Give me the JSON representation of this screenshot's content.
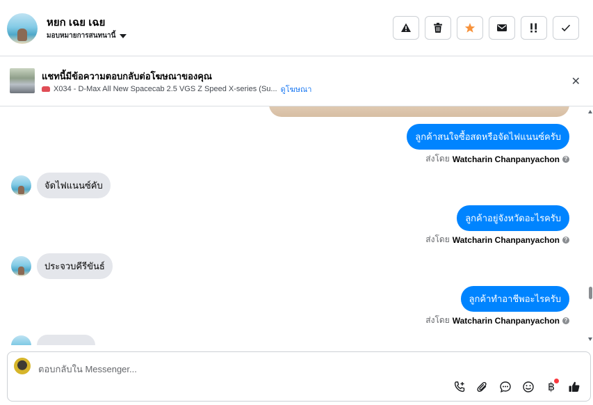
{
  "header": {
    "name": "หยก เฉย เฉย",
    "assign_label": "มอบหมายการสนทนานี้",
    "actions": [
      {
        "name": "report-spam-button",
        "icon": "warning-triangle-icon",
        "glyph": "⚠"
      },
      {
        "name": "delete-button",
        "icon": "trash-icon",
        "glyph": "🗑"
      },
      {
        "name": "star-button",
        "icon": "star-icon",
        "glyph": "★",
        "color": "#f7923b"
      },
      {
        "name": "email-button",
        "icon": "envelope-icon",
        "glyph": "✉"
      },
      {
        "name": "follow-up-button",
        "icon": "double-exclamation-icon",
        "glyph": "!!"
      },
      {
        "name": "mark-done-button",
        "icon": "checkmark-icon",
        "glyph": "✓"
      }
    ]
  },
  "ad": {
    "title": "แชทนี้มีข้อความตอบกลับต่อโฆษณาของคุณ",
    "subtitle": "X034 - D-Max All New Spacecab 2.5 VGS Z Speed X-series (Su...",
    "link": "ดูโฆษณา",
    "close": "✕"
  },
  "messages": [
    {
      "dir": "out",
      "text": "ลูกค้าสนใจซื้อสดหรือจัดไฟแนนซ์ครับ",
      "sent_by_label": "ส่งโดย",
      "sender": "Watcharin Chanpanyachon"
    },
    {
      "dir": "in",
      "text": "จัดไฟแนนซ์คับ"
    },
    {
      "dir": "out",
      "text": "ลูกค้าอยู่จังหวัดอะไรครับ",
      "sent_by_label": "ส่งโดย",
      "sender": "Watcharin Chanpanyachon"
    },
    {
      "dir": "in",
      "text": "ประจวบคีรีขันธ์"
    },
    {
      "dir": "out",
      "text": "ลูกค้าทำอาชีพอะไรครับ",
      "sent_by_label": "ส่งโดย",
      "sender": "Watcharin Chanpanyachon"
    }
  ],
  "composer": {
    "placeholder": "ตอบกลับใน Messenger...",
    "tools": [
      "phone-add-icon",
      "paperclip-icon",
      "chat-bubble-icon",
      "smiley-icon",
      "baht-icon",
      "thumbs-up-icon"
    ],
    "baht_glyph": "฿"
  },
  "colors": {
    "outgoing_bubble": "#0084ff",
    "incoming_bubble": "#e4e6eb",
    "link": "#1877f2",
    "notification_dot": "#fa383e"
  }
}
